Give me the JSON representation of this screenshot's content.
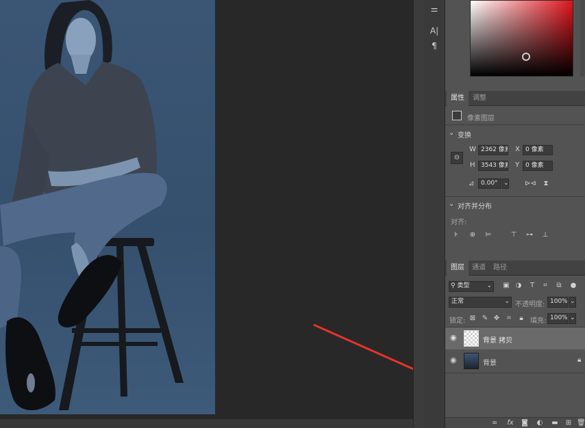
{
  "properties_panel": {
    "tabs": [
      "属性",
      "调整"
    ],
    "layer_kind": "像素图层",
    "transform_title": "变换",
    "w_label": "W",
    "w_value": "2362 像素",
    "h_label": "H",
    "h_value": "3543 像素",
    "x_label": "X",
    "x_value": "0 像素",
    "y_label": "Y",
    "y_value": "0 像素",
    "angle_value": "0.00°",
    "align_title": "对齐并分布",
    "align_label": "对齐:"
  },
  "layers_panel": {
    "tabs": [
      "图层",
      "通道",
      "路径"
    ],
    "filter_kind": "类型",
    "blend_mode": "正常",
    "opacity_label": "不透明度:",
    "opacity_value": "100%",
    "lock_label": "锁定:",
    "fill_label": "填充:",
    "fill_value": "100%",
    "layers": [
      {
        "name": "背景 拷贝",
        "selected": true,
        "locked": false
      },
      {
        "name": "背景",
        "selected": false,
        "locked": true
      }
    ],
    "bottom_icons": [
      "link-icon",
      "fx-icon",
      "add-mask-icon",
      "adjustment-icon",
      "group-folder-icon",
      "new-layer-icon",
      "trash-icon"
    ]
  },
  "colors": {
    "accent_arrow": "#e8332a",
    "panel_bg": "#535353",
    "canvas_bg": "#282828"
  }
}
